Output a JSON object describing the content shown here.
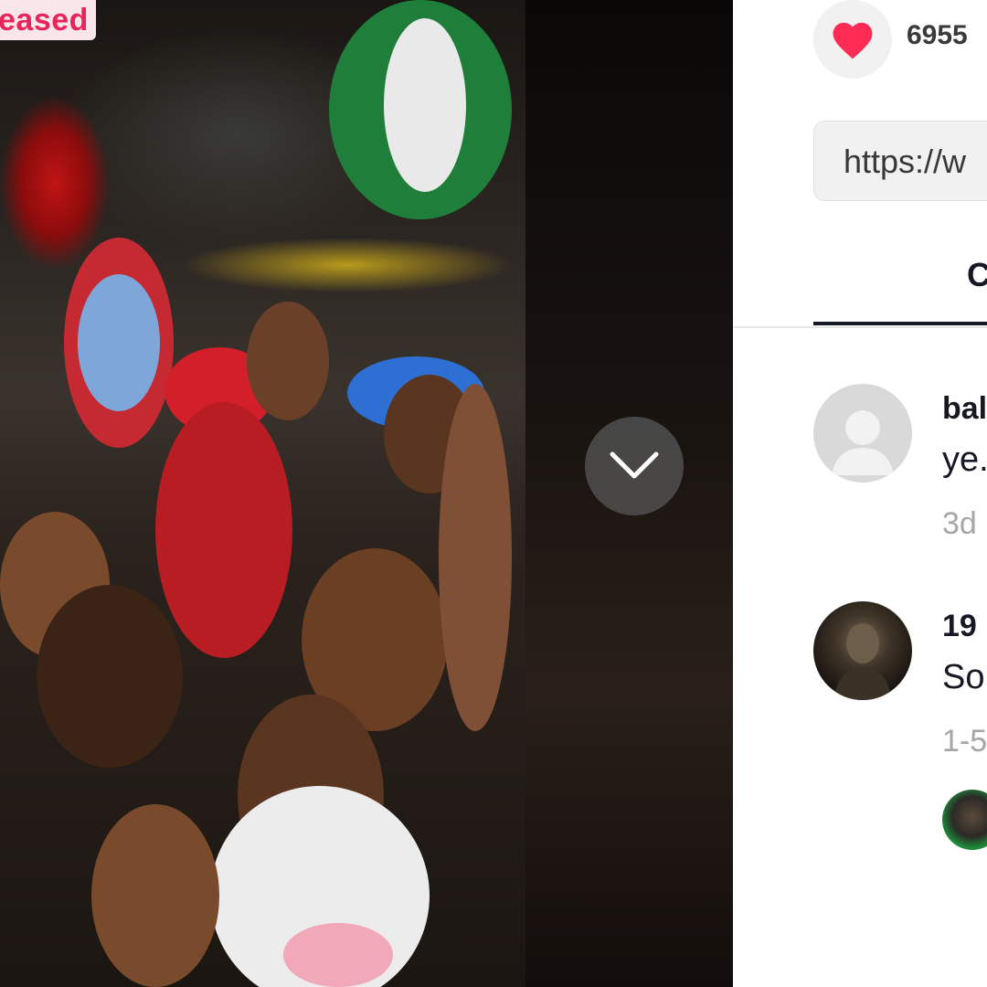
{
  "video": {
    "caption_fragment": "eased",
    "scroll_icon": "chevron-down-icon"
  },
  "panel": {
    "like_icon": "heart-icon",
    "like_count": "6955",
    "link_text": "https://w",
    "tab_label": "C",
    "accent_color": "#fe2c55"
  },
  "comments": [
    {
      "username": "bal",
      "text": "ye.",
      "time": "3d",
      "avatar": "default-avatar-icon"
    },
    {
      "username": "19",
      "text": "So",
      "time": "1-5",
      "avatar": "user-photo-avatar"
    }
  ]
}
